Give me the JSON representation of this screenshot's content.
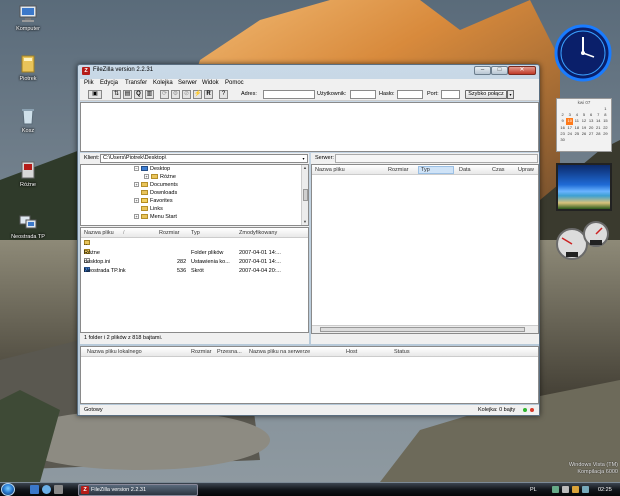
{
  "desktop": {
    "icons": [
      {
        "label": "Komputer"
      },
      {
        "label": "Piotrek"
      },
      {
        "label": "Kosz"
      },
      {
        "label": "Różne"
      },
      {
        "label": "Neostrada TP"
      }
    ],
    "watermark_line1": "Windows Vista (TM)",
    "watermark_line2": "Kompilacja 6000"
  },
  "calendar": {
    "month": "kwi 07",
    "days": [
      "",
      "",
      "",
      "",
      "",
      "",
      "1",
      "2",
      "3",
      "4",
      "5",
      "6",
      "7",
      "8",
      "9",
      "10",
      "11",
      "12",
      "13",
      "14",
      "15",
      "16",
      "17",
      "18",
      "19",
      "20",
      "21",
      "22",
      "23",
      "24",
      "25",
      "26",
      "27",
      "28",
      "29",
      "30"
    ],
    "today": "10"
  },
  "taskbar": {
    "task_title": "FileZilla version 2.2.31",
    "lang": "PL",
    "time": "02:25"
  },
  "window": {
    "title": "FileZilla version 2.2.31",
    "caption_min": "–",
    "caption_max": "□",
    "caption_close": "✕"
  },
  "menu": [
    "Plik",
    "Edycja",
    "Transfer",
    "Kolejka",
    "Serwer",
    "Widok",
    "Pomoc"
  ],
  "quickconnect": {
    "host_label": "Adres:",
    "user_label": "Użytkownik:",
    "pass_label": "Hasło:",
    "port_label": "Port:",
    "button_label": "Szybko połącz",
    "dropdown": "▾"
  },
  "local": {
    "path_label": "Klient:",
    "path_value": "C:\\Users\\Piotrek\\Desktop\\",
    "tree": [
      {
        "label": "Desktop",
        "expander": "−",
        "kind": "blue"
      },
      {
        "label": "Różne",
        "expander": "+",
        "kind": "folder"
      },
      {
        "label": "Documents",
        "expander": "+",
        "kind": "folder"
      },
      {
        "label": "Downloads",
        "expander": "",
        "kind": "folder"
      },
      {
        "label": "Favorites",
        "expander": "+",
        "kind": "fav"
      },
      {
        "label": "Links",
        "expander": "",
        "kind": "folder"
      },
      {
        "label": "Menu Start",
        "expander": "+",
        "kind": "folder"
      }
    ],
    "columns": {
      "name": "Nazwa pliku",
      "sort": "/",
      "size": "Rozmiar",
      "type": "Typ",
      "modified": "Zmodyfikowany"
    },
    "files": [
      {
        "name": "..",
        "size": "",
        "type": "",
        "modified": "",
        "kind": "up"
      },
      {
        "name": "Różne",
        "size": "",
        "type": "Folder plików",
        "modified": "2007-04-01 14:...",
        "kind": "folder"
      },
      {
        "name": "desktop.ini",
        "size": "282",
        "type": "Ustawienia ko...",
        "modified": "2007-04-01 14:...",
        "kind": "ini"
      },
      {
        "name": "Neostrada TP.lnk",
        "size": "536",
        "type": "Skrót",
        "modified": "2007-04-04 20:...",
        "kind": "lnk"
      }
    ],
    "status": "1 folder i 2 plików z 818 bajtami."
  },
  "remote": {
    "path_label": "Serwer:",
    "columns": {
      "name": "Nazwa pliku",
      "size": "Rozmiar",
      "type": "Typ",
      "date": "Data",
      "time": "Czas",
      "perms": "Upraw"
    }
  },
  "queue": {
    "columns": {
      "local": "Nazwa pliku lokalnego",
      "size": "Rozmiar",
      "direction": "Przesna...",
      "remote": "Nazwa pliku na serwerze",
      "host": "Host",
      "status": "Status"
    }
  },
  "statusbar": {
    "ready": "Gotowy",
    "queue": "Kolejka: 0 bajty"
  },
  "colors": {
    "accent": "#b51b17",
    "selection": "#cfe3f7",
    "led_green": "#2fb52f",
    "led_red": "#d83a2a"
  }
}
